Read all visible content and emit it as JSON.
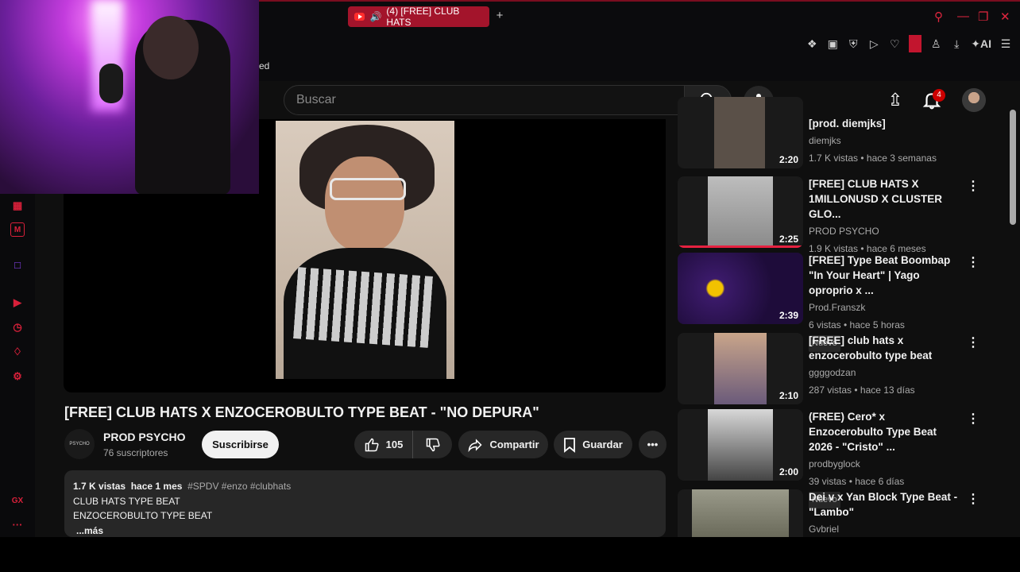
{
  "browser": {
    "tab_title": "(4) [FREE] CLUB HATS",
    "url_fragment": "ed",
    "ai_label": "AI"
  },
  "youtube": {
    "search_placeholder": "Buscar",
    "notifications_count": "4"
  },
  "video": {
    "title": "[FREE] CLUB HATS X ENZOCEROBULTO TYPE BEAT - \"NO DEPURA\"",
    "channel": "PROD PSYCHO",
    "subscribers": "76 suscriptores",
    "subscribe_label": "Suscribirse",
    "likes": "105",
    "share_label": "Compartir",
    "save_label": "Guardar",
    "description": {
      "views": "1.7 K vistas",
      "time": "hace 1 mes",
      "tags": "#SPDV #enzo #clubhats",
      "line1": "CLUB HATS TYPE BEAT",
      "line2": "ENZOCEROBULTO TYPE BEAT",
      "more": "...más"
    }
  },
  "recommendations": [
    {
      "title": "[prod. diemjks]",
      "channel": "diemjks",
      "meta": "1.7 K vistas • hace 3 semanas",
      "duration": "2:20",
      "new": ""
    },
    {
      "title": "[FREE] CLUB HATS X 1MILLONUSD X CLUSTER GLO...",
      "channel": "PROD PSYCHO",
      "meta": "1.9 K vistas • hace 6 meses",
      "duration": "2:25",
      "new": "",
      "watched_fraction": 1.0
    },
    {
      "title": "[FREE] Type Beat Boombap \"In Your Heart\" | Yago oproprio x ...",
      "channel": "Prod.Franszk",
      "meta": "6 vistas • hace 5 horas",
      "duration": "2:39",
      "new": "Nuevo"
    },
    {
      "title": "[FREE] club hats x enzocerobulto type beat",
      "channel": "ggggodzan",
      "meta": "287 vistas • hace 13 días",
      "duration": "2:10",
      "new": ""
    },
    {
      "title": "(FREE) Cero* x Enzocerobulto Type Beat 2026 - \"Cristo\" ...",
      "channel": "prodbyglock",
      "meta": "39 vistas • hace 6 días",
      "duration": "2:00",
      "new": "Nuevo"
    },
    {
      "title": "Dei v x Yan Block Type Beat - \"Lambo\"",
      "channel": "Gvbriel",
      "meta": "",
      "duration": "",
      "new": ""
    }
  ],
  "colors": {
    "accent": "#e62140",
    "opera_red": "#d8203a",
    "yt_bg": "#0f0f0f"
  }
}
